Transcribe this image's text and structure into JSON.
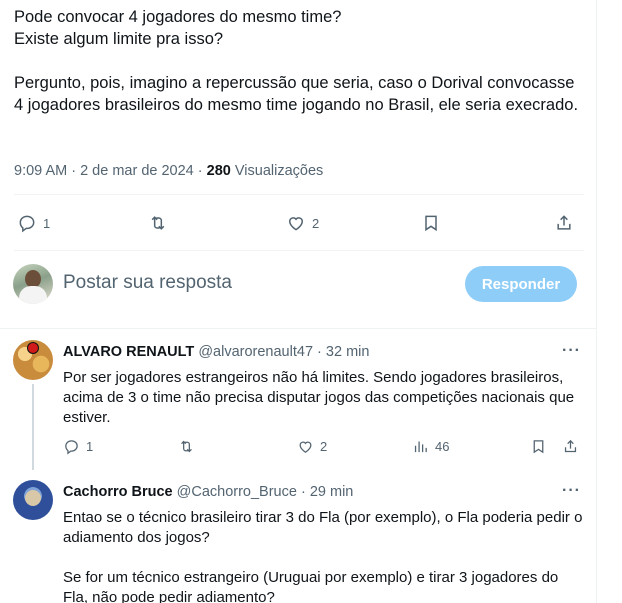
{
  "tweet": {
    "text": "Pode convocar 4 jogadores do mesmo time?\nExiste algum limite pra isso?\n\nPergunto, pois, imagino a repercussão que seria, caso o Dorival convocasse 4 jogadores brasileiros do mesmo time jogando no Brasil, ele seria execrado.",
    "time": "9:09 AM · 2 de mar de 2024 · ",
    "views_count": "280",
    "views_label": " Visualizações"
  },
  "actions": {
    "replies": "1",
    "retweets": "",
    "likes": "2"
  },
  "reply_composer": {
    "placeholder": "Postar sua resposta",
    "button_label": "Responder"
  },
  "replies": [
    {
      "name": "ALVARO RENAULT",
      "handle": "@alvarorenault47",
      "time": "32 min",
      "text": "Por ser jogadores estrangeiros não há limites. Sendo jogadores brasileiros, acima de 3 o time não precisa disputar jogos das competições nacionais que estiver.",
      "replies": "1",
      "likes": "2",
      "views": "46"
    },
    {
      "name": "Cachorro Bruce",
      "handle": "@Cachorro_Bruce",
      "time": "29 min",
      "text": "Entao se o técnico brasileiro tirar 3 do Fla (por exemplo), o Fla poderia pedir o adiamento dos jogos?\n\nSe for um técnico estrangeiro (Uruguai por exemplo) e tirar 3 jogadores do Fla, não pode pedir adiamento?"
    }
  ],
  "more_icon_text": "···",
  "separator": " · ",
  "colors": {
    "text": "#0f1419",
    "secondary": "#536471",
    "accent_disabled": "#8ecdf7",
    "border": "#eff3f4"
  },
  "icons": [
    "reply-icon",
    "retweet-icon",
    "like-icon",
    "bookmark-icon",
    "share-icon",
    "views-icon",
    "more-icon"
  ]
}
